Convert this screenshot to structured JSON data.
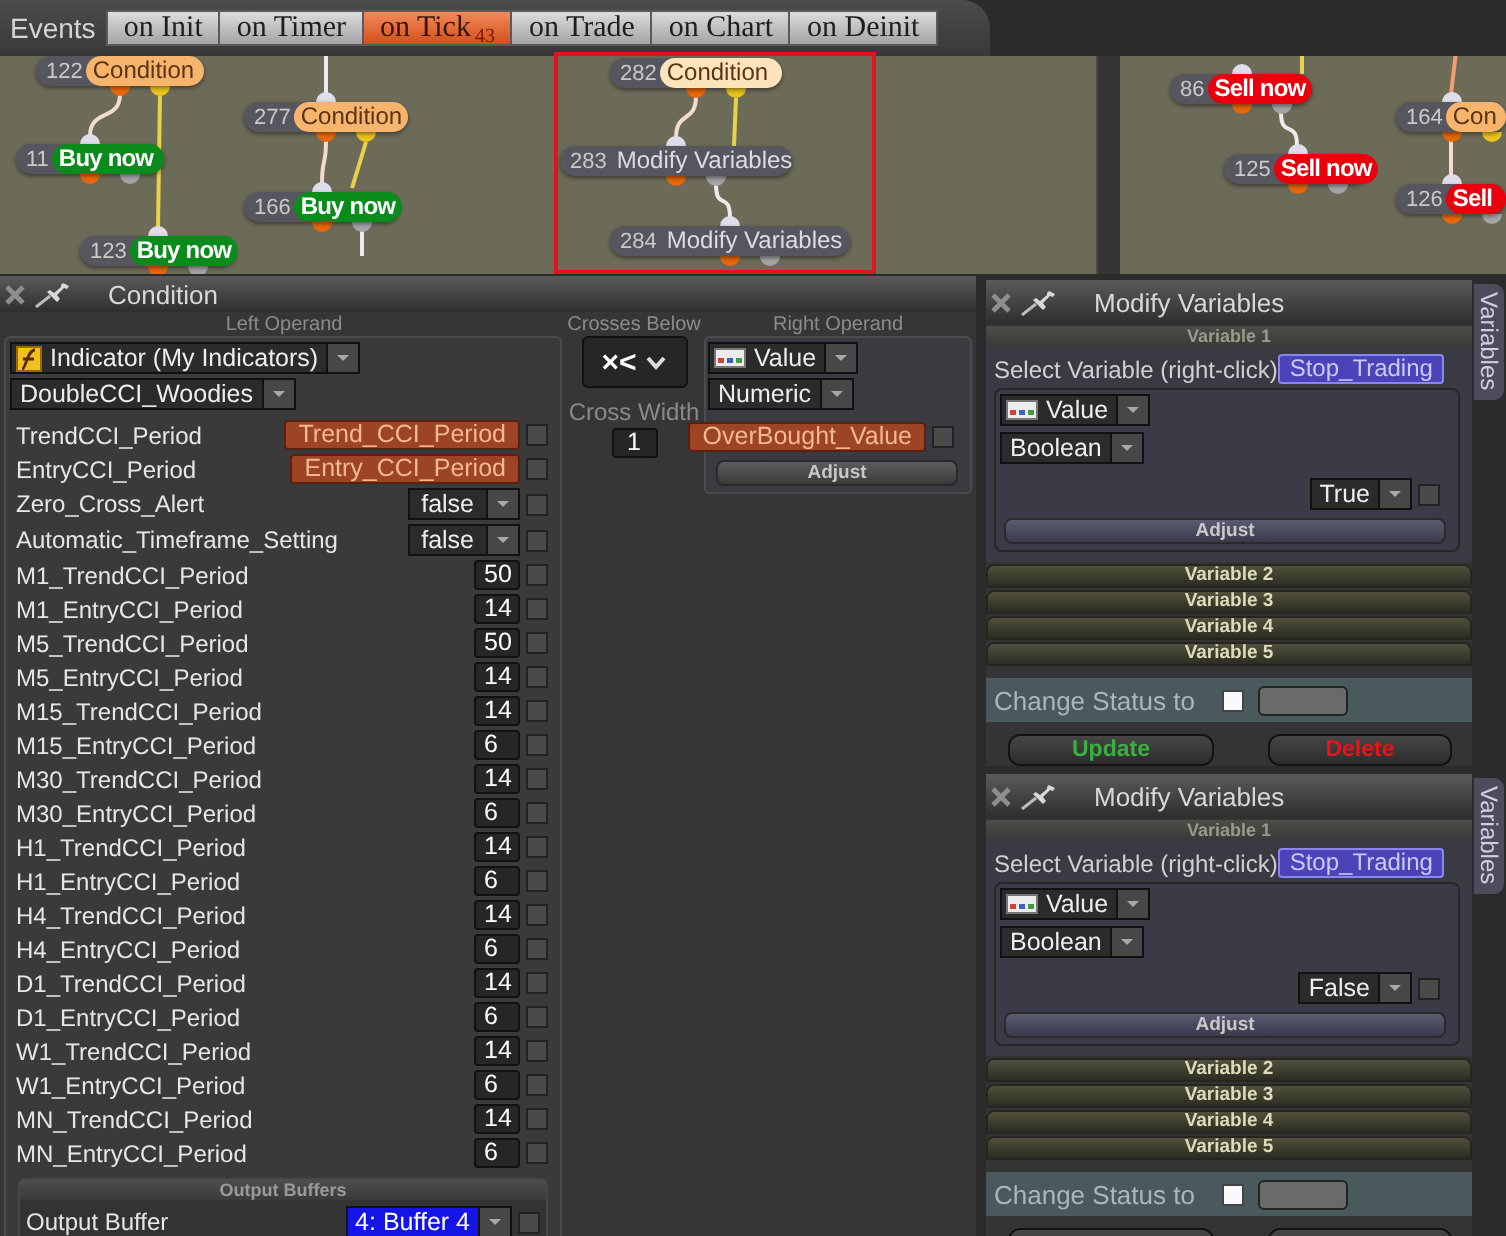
{
  "events_bar": {
    "label": "Events",
    "tabs": [
      {
        "label": "on Init",
        "selected": false
      },
      {
        "label": "on Timer",
        "selected": false
      },
      {
        "label": "on Tick",
        "count": "43",
        "selected": true
      },
      {
        "label": "on Trade",
        "selected": false
      },
      {
        "label": "on Chart",
        "selected": false
      },
      {
        "label": "on Deinit",
        "selected": false
      }
    ]
  },
  "canvas_panes": [
    {
      "nodes": [
        {
          "number": "122",
          "label": "Condition",
          "kind": "condition",
          "selected": false
        },
        {
          "number": "11",
          "label": "Buy now",
          "kind": "buy",
          "selected": false
        },
        {
          "number": "123",
          "label": "Buy now",
          "kind": "buy",
          "selected": false
        },
        {
          "number": "277",
          "label": "Condition",
          "kind": "condition",
          "selected": false
        },
        {
          "number": "166",
          "label": "Buy now",
          "kind": "buy",
          "selected": false
        },
        {
          "number": "282",
          "label": "Condition",
          "kind": "condition",
          "selected": true
        },
        {
          "number": "283",
          "label": "Modify Variables",
          "kind": "modify",
          "selected": false
        },
        {
          "number": "284",
          "label": "Modify Variables",
          "kind": "modify",
          "selected": false
        }
      ]
    },
    {
      "nodes": [
        {
          "number": "86",
          "label": "Sell now",
          "kind": "sell",
          "selected": false
        },
        {
          "number": "125",
          "label": "Sell now",
          "kind": "sell",
          "selected": false
        },
        {
          "number": "164",
          "label": "Con",
          "kind": "condition",
          "selected": false
        },
        {
          "number": "126",
          "label": "Sell",
          "kind": "sell",
          "selected": false
        }
      ]
    }
  ],
  "condition_panel": {
    "title": "Condition",
    "left_operand": {
      "heading": "Left Operand",
      "source": "Indicator (My Indicators)",
      "indicator": "DoubleCCI_Woodies",
      "params": [
        {
          "name": "TrendCCI_Period",
          "kind": "variable",
          "value": "Trend_CCI_Period",
          "checked": false
        },
        {
          "name": "EntryCCI_Period",
          "kind": "variable",
          "value": "Entry_CCI_Period",
          "checked": false
        },
        {
          "name": "Zero_Cross_Alert",
          "kind": "dropdown",
          "value": "false",
          "checked": false
        },
        {
          "name": "Automatic_Timeframe_Setting",
          "kind": "dropdown",
          "value": "false",
          "checked": false
        },
        {
          "name": "M1_TrendCCI_Period",
          "kind": "number",
          "value": "50",
          "checked": false
        },
        {
          "name": "M1_EntryCCI_Period",
          "kind": "number",
          "value": "14",
          "checked": false
        },
        {
          "name": "M5_TrendCCI_Period",
          "kind": "number",
          "value": "50",
          "checked": false
        },
        {
          "name": "M5_EntryCCI_Period",
          "kind": "number",
          "value": "14",
          "checked": false
        },
        {
          "name": "M15_TrendCCI_Period",
          "kind": "number",
          "value": "14",
          "checked": false
        },
        {
          "name": "M15_EntryCCI_Period",
          "kind": "number",
          "value": "6",
          "checked": false
        },
        {
          "name": "M30_TrendCCI_Period",
          "kind": "number",
          "value": "14",
          "checked": false
        },
        {
          "name": "M30_EntryCCI_Period",
          "kind": "number",
          "value": "6",
          "checked": false
        },
        {
          "name": "H1_TrendCCI_Period",
          "kind": "number",
          "value": "14",
          "checked": false
        },
        {
          "name": "H1_EntryCCI_Period",
          "kind": "number",
          "value": "6",
          "checked": false
        },
        {
          "name": "H4_TrendCCI_Period",
          "kind": "number",
          "value": "14",
          "checked": false
        },
        {
          "name": "H4_EntryCCI_Period",
          "kind": "number",
          "value": "6",
          "checked": false
        },
        {
          "name": "D1_TrendCCI_Period",
          "kind": "number",
          "value": "14",
          "checked": false
        },
        {
          "name": "D1_EntryCCI_Period",
          "kind": "number",
          "value": "6",
          "checked": false
        },
        {
          "name": "W1_TrendCCI_Period",
          "kind": "number",
          "value": "14",
          "checked": false
        },
        {
          "name": "W1_EntryCCI_Period",
          "kind": "number",
          "value": "6",
          "checked": false
        },
        {
          "name": "MN_TrendCCI_Period",
          "kind": "number",
          "value": "14",
          "checked": false
        },
        {
          "name": "MN_EntryCCI_Period",
          "kind": "number",
          "value": "6",
          "checked": false
        }
      ],
      "output_buffers": {
        "heading": "Output Buffers",
        "label": "Output Buffer",
        "value": "4: Buffer 4",
        "checked": false
      }
    },
    "operator": {
      "heading": "Crosses Below",
      "value": "×<"
    },
    "cross_width": {
      "label": "Cross Width",
      "value": "1"
    },
    "right_operand": {
      "heading": "Right Operand",
      "type": "Value",
      "format": "Numeric",
      "value": "OverBought_Value",
      "checked": false,
      "button": "Adjust"
    }
  },
  "modify_panels": [
    {
      "title": "Modify Variables",
      "side_tab": "Variables",
      "variables": [
        {
          "title": "Variable 1",
          "expanded": true,
          "select_label": "Select Variable (right-click)",
          "variable": "Stop_Trading",
          "type": "Value",
          "format": "Boolean",
          "value": "True",
          "checked": false,
          "button": "Adjust"
        },
        {
          "title": "Variable 2",
          "expanded": false
        },
        {
          "title": "Variable 3",
          "expanded": false
        },
        {
          "title": "Variable 4",
          "expanded": false
        },
        {
          "title": "Variable 5",
          "expanded": false
        }
      ],
      "status": {
        "label": "Change Status to",
        "checked": false
      },
      "buttons": [
        {
          "label": "Update",
          "kind": "update"
        },
        {
          "label": "Delete",
          "kind": "delete"
        }
      ]
    },
    {
      "title": "Modify Variables",
      "side_tab": "Variables",
      "variables": [
        {
          "title": "Variable 1",
          "expanded": true,
          "select_label": "Select Variable (right-click)",
          "variable": "Stop_Trading",
          "type": "Value",
          "format": "Boolean",
          "value": "False",
          "checked": false,
          "button": "Adjust"
        },
        {
          "title": "Variable 2",
          "expanded": false
        },
        {
          "title": "Variable 3",
          "expanded": false
        },
        {
          "title": "Variable 4",
          "expanded": false
        },
        {
          "title": "Variable 5",
          "expanded": false
        }
      ],
      "status": {
        "label": "Change Status to",
        "checked": false
      },
      "buttons": [
        {
          "kind": "update"
        },
        {
          "kind": "delete"
        }
      ]
    }
  ]
}
